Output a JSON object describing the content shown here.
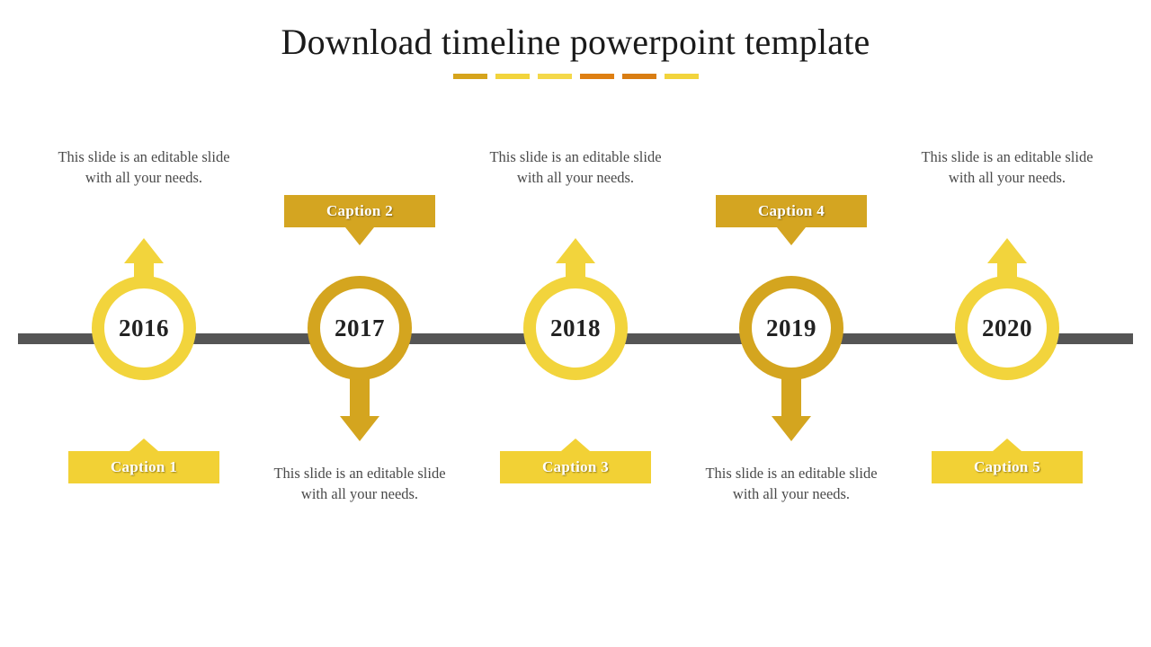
{
  "slide": {
    "title": "Download timeline powerpoint template",
    "background_color": "#FFFFFF",
    "title_color": "#1A1A1A"
  },
  "title_underline": {
    "dashes": [
      {
        "color": "#D6A41C"
      },
      {
        "color": "#F2D43C"
      },
      {
        "color": "#F4D84A"
      },
      {
        "color": "#DE7F12"
      },
      {
        "color": "#D97D12"
      },
      {
        "color": "#F2D43C"
      }
    ]
  },
  "timeline_axis": {
    "color": "#555555"
  },
  "palette": {
    "light_yellow": "#F2D43C",
    "dark_gold": "#D4A51F",
    "caption_light": "#F2D135",
    "caption_dark": "#D4A521",
    "axis_gray": "#555555",
    "year_text": "#222222",
    "body_text": "#4A4A4A"
  },
  "nodes": [
    {
      "year": "2016",
      "caption": "Caption  1",
      "body": "This slide is an editable slide with all your needs.",
      "orientation": "up",
      "ring_color": "#F2D43C",
      "arrow_color": "#F2D43C",
      "caption_color": "#F2D135",
      "caption_position": "below",
      "body_position": "top"
    },
    {
      "year": "2017",
      "caption": "Caption   2",
      "body": "This slide is an editable slide with all your needs.",
      "orientation": "down",
      "ring_color": "#D4A51F",
      "arrow_color": "#D4A51F",
      "caption_color": "#D4A521",
      "caption_position": "above",
      "body_position": "bottom"
    },
    {
      "year": "2018",
      "caption": "Caption   3",
      "body": "This slide is an editable slide with all your needs.",
      "orientation": "up",
      "ring_color": "#F2D43C",
      "arrow_color": "#F2D43C",
      "caption_color": "#F2D135",
      "caption_position": "below",
      "body_position": "top"
    },
    {
      "year": "2019",
      "caption": "Caption   4",
      "body": "This slide is an editable slide with all your needs.",
      "orientation": "down",
      "ring_color": "#D4A51F",
      "arrow_color": "#D4A51F",
      "caption_color": "#D4A521",
      "caption_position": "above",
      "body_position": "bottom"
    },
    {
      "year": "2020",
      "caption": "Caption   5",
      "body": "This slide is an editable slide with all your needs.",
      "orientation": "up",
      "ring_color": "#F2D43C",
      "arrow_color": "#F2D43C",
      "caption_color": "#F2D135",
      "caption_position": "below",
      "body_position": "top"
    }
  ]
}
